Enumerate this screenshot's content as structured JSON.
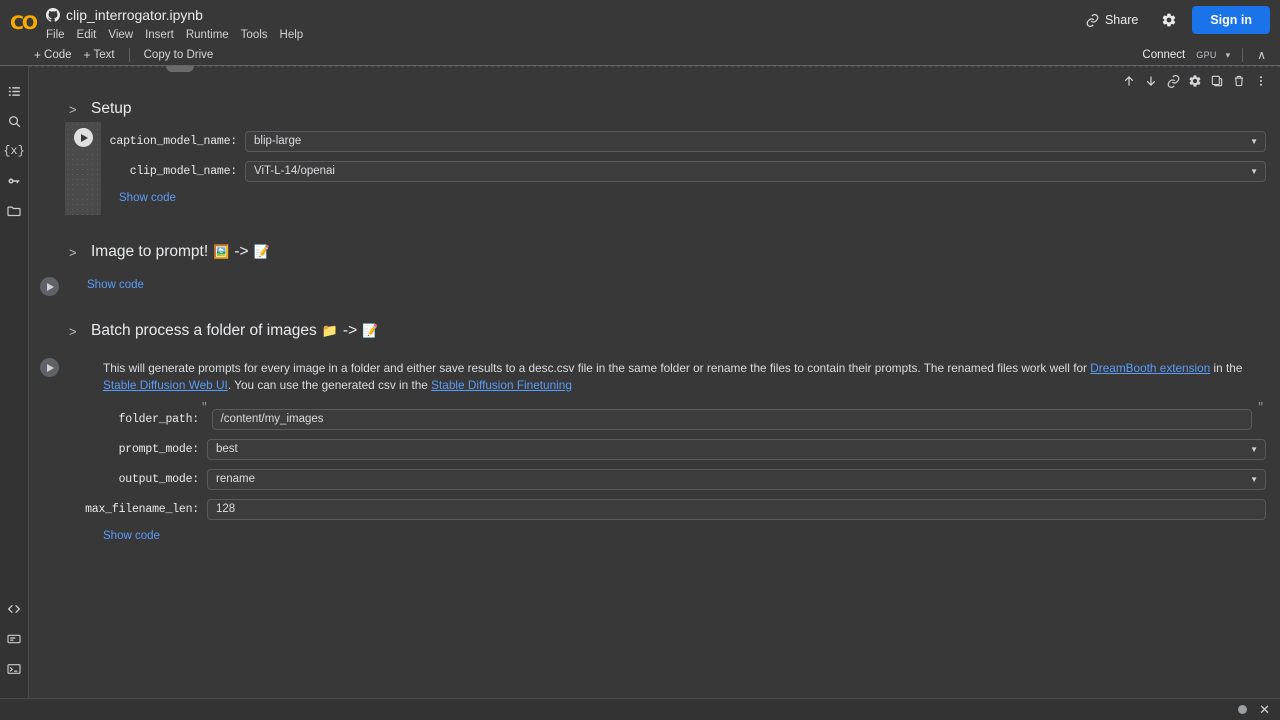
{
  "header": {
    "logo_text": "CO",
    "doc_title": "clip_interrogator.ipynb",
    "github_icon": "github-icon",
    "menu": [
      {
        "label": "File"
      },
      {
        "label": "Edit"
      },
      {
        "label": "View"
      },
      {
        "label": "Insert"
      },
      {
        "label": "Runtime"
      },
      {
        "label": "Tools"
      },
      {
        "label": "Help"
      }
    ],
    "share_label": "Share",
    "share_icon": "link-icon",
    "settings_icon": "gear-icon",
    "signin_label": "Sign in"
  },
  "toolbar": {
    "add_code_label": "Code",
    "add_text_label": "Text",
    "plus": "+",
    "copy_to_drive_label": "Copy to Drive",
    "connect_label": "Connect",
    "gpu_badge": "GPU",
    "connect_caret": "▾",
    "collapse_chevron": "∧"
  },
  "cell_toolbar": {
    "items": [
      {
        "name": "move-cell-up-icon",
        "glyph": "↑"
      },
      {
        "name": "move-cell-down-icon",
        "glyph": "↓"
      },
      {
        "name": "link-to-cell-icon",
        "glyph": "link"
      },
      {
        "name": "cell-settings-icon",
        "glyph": "gear"
      },
      {
        "name": "copy-cell-icon",
        "glyph": "copy"
      },
      {
        "name": "delete-cell-icon",
        "glyph": "trash"
      },
      {
        "name": "more-options-icon",
        "glyph": "⋮"
      }
    ]
  },
  "sidebar": {
    "items": [
      {
        "name": "table-of-contents-icon",
        "label": "Table of contents"
      },
      {
        "name": "search-icon",
        "label": "Find and replace"
      },
      {
        "name": "variables-icon",
        "label": "Variables"
      },
      {
        "name": "secrets-key-icon",
        "label": "Secrets"
      },
      {
        "name": "files-folder-icon",
        "label": "Files"
      }
    ],
    "bottom_items": [
      {
        "name": "code-snippets-icon",
        "label": "Code snippets"
      },
      {
        "name": "command-palette-icon",
        "label": "Command palette"
      },
      {
        "name": "terminal-icon",
        "label": "Terminal"
      }
    ]
  },
  "notebook": {
    "sections": [
      {
        "id": "setup",
        "chevron": ">",
        "title": "Setup",
        "emojis": [],
        "show_code_label": "Show code",
        "fields": [
          {
            "name": "caption_model_name",
            "label": "caption_model_name:",
            "type": "select",
            "value": "blip-large"
          },
          {
            "name": "clip_model_name",
            "label": "clip_model_name:",
            "type": "select",
            "value": "ViT-L-14/openai"
          }
        ]
      },
      {
        "id": "image-to-prompt",
        "chevron": ">",
        "title": "Image to prompt!",
        "emojis": [
          "🖼️",
          "->",
          "📝"
        ],
        "show_code_label": "Show code",
        "fields": []
      },
      {
        "id": "batch-process",
        "chevron": ">",
        "title": "Batch process a folder of images",
        "emojis": [
          "📁",
          "->",
          "📝"
        ],
        "show_code_label": "Show code",
        "description": {
          "part1": "This will generate prompts for every image in a folder and either save results to a desc.csv file in the same folder or rename the files to contain their prompts. The renamed files work well for ",
          "link1": "DreamBooth extension",
          "part2": " in the ",
          "link2": "Stable Diffusion Web UI",
          "part3": ". You can use the generated csv in the ",
          "link3": "Stable Diffusion Finetuning"
        },
        "fields": [
          {
            "name": "folder_path",
            "label": "folder_path:",
            "type": "text",
            "value": "/content/my_images",
            "quote": "\""
          },
          {
            "name": "prompt_mode",
            "label": "prompt_mode:",
            "type": "select",
            "value": "best"
          },
          {
            "name": "output_mode",
            "label": "output_mode:",
            "type": "select",
            "value": "rename"
          },
          {
            "name": "max_filename_len",
            "label": "max_filename_len:",
            "type": "number",
            "value": "128"
          }
        ]
      }
    ]
  },
  "statusbar": {
    "dot_icon": "status-dot-icon",
    "close_icon": "✕"
  },
  "colors": {
    "background": "#383838",
    "accent_blue": "#1a73e8",
    "link_blue": "#5a9cf8",
    "logo_orange": "#F9AB00"
  }
}
